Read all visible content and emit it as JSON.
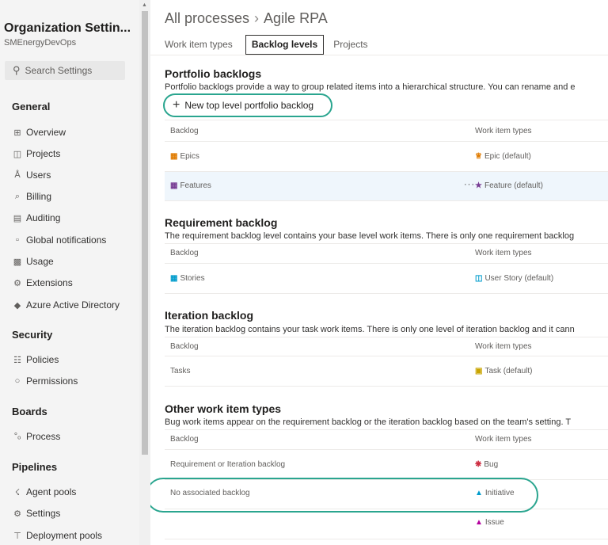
{
  "sidebar": {
    "org_title": "Organization Settin...",
    "org_subtitle": "SMEnergyDevOps",
    "search_placeholder": "Search Settings",
    "sections": [
      {
        "title": "General",
        "items": [
          {
            "label": "Overview",
            "icon": "overview-icon"
          },
          {
            "label": "Projects",
            "icon": "projects-icon"
          },
          {
            "label": "Users",
            "icon": "users-icon"
          },
          {
            "label": "Billing",
            "icon": "billing-icon"
          },
          {
            "label": "Auditing",
            "icon": "auditing-icon"
          },
          {
            "label": "Global notifications",
            "icon": "notifications-icon"
          },
          {
            "label": "Usage",
            "icon": "usage-icon"
          },
          {
            "label": "Extensions",
            "icon": "extensions-icon"
          },
          {
            "label": "Azure Active Directory",
            "icon": "azure-ad-icon"
          }
        ]
      },
      {
        "title": "Security",
        "items": [
          {
            "label": "Policies",
            "icon": "policies-icon"
          },
          {
            "label": "Permissions",
            "icon": "permissions-icon"
          }
        ]
      },
      {
        "title": "Boards",
        "items": [
          {
            "label": "Process",
            "icon": "process-icon",
            "selected": true
          }
        ]
      },
      {
        "title": "Pipelines",
        "items": [
          {
            "label": "Agent pools",
            "icon": "agent-pools-icon"
          },
          {
            "label": "Settings",
            "icon": "settings-icon"
          },
          {
            "label": "Deployment pools",
            "icon": "deployment-pools-icon"
          }
        ]
      }
    ]
  },
  "breadcrumb": {
    "root": "All processes",
    "current": "Agile RPA"
  },
  "tabs": [
    "Work item types",
    "Backlog levels",
    "Projects"
  ],
  "active_tab": "Backlog levels",
  "portfolio": {
    "title": "Portfolio backlogs",
    "description": "Portfolio backlogs provide a way to group related items into a hierarchical structure. You can rename and e",
    "new_button": "New top level portfolio backlog",
    "col_backlog": "Backlog",
    "col_types": "Work item types",
    "rows": [
      {
        "backlog": "Epics",
        "type": "Epic (default)",
        "backlog_color": "#e07b00",
        "type_icon": "crown-icon",
        "type_color": "#e07b00"
      },
      {
        "backlog": "Features",
        "type": "Feature (default)",
        "backlog_color": "#773b93",
        "type_icon": "trophy-icon",
        "type_color": "#773b93",
        "selected": true
      }
    ]
  },
  "requirement": {
    "title": "Requirement backlog",
    "description": "The requirement backlog level contains your base level work items. There is only one requirement backlog",
    "col_backlog": "Backlog",
    "col_types": "Work item types",
    "rows": [
      {
        "backlog": "Stories",
        "type": "User Story (default)",
        "backlog_color": "#009ccc",
        "type_icon": "book-icon",
        "type_color": "#009ccc"
      }
    ]
  },
  "iteration": {
    "title": "Iteration backlog",
    "description": "The iteration backlog contains your task work items. There is only one level of iteration backlog and it cann",
    "col_backlog": "Backlog",
    "col_types": "Work item types",
    "rows": [
      {
        "backlog": "Tasks",
        "type": "Task (default)",
        "type_icon": "clipboard-icon",
        "type_color": "#c9a400"
      }
    ]
  },
  "other": {
    "title": "Other work item types",
    "description": "Bug work items appear on the requirement backlog or the iteration backlog based on the team's setting. T",
    "col_backlog": "Backlog",
    "col_types": "Work item types",
    "rows": [
      {
        "backlog": "Requirement or Iteration backlog",
        "type": "Bug",
        "type_icon": "bug-icon",
        "type_color": "#cc293d"
      },
      {
        "backlog": "No associated backlog",
        "type": "Initiative",
        "type_icon": "flask-icon",
        "type_color": "#009ccc"
      },
      {
        "backlog": "",
        "type": "Issue",
        "type_icon": "flask-icon",
        "type_color": "#b4009e"
      }
    ]
  },
  "colors": {
    "callout": "#2aa58f",
    "selected_row": "#eff6fc"
  }
}
